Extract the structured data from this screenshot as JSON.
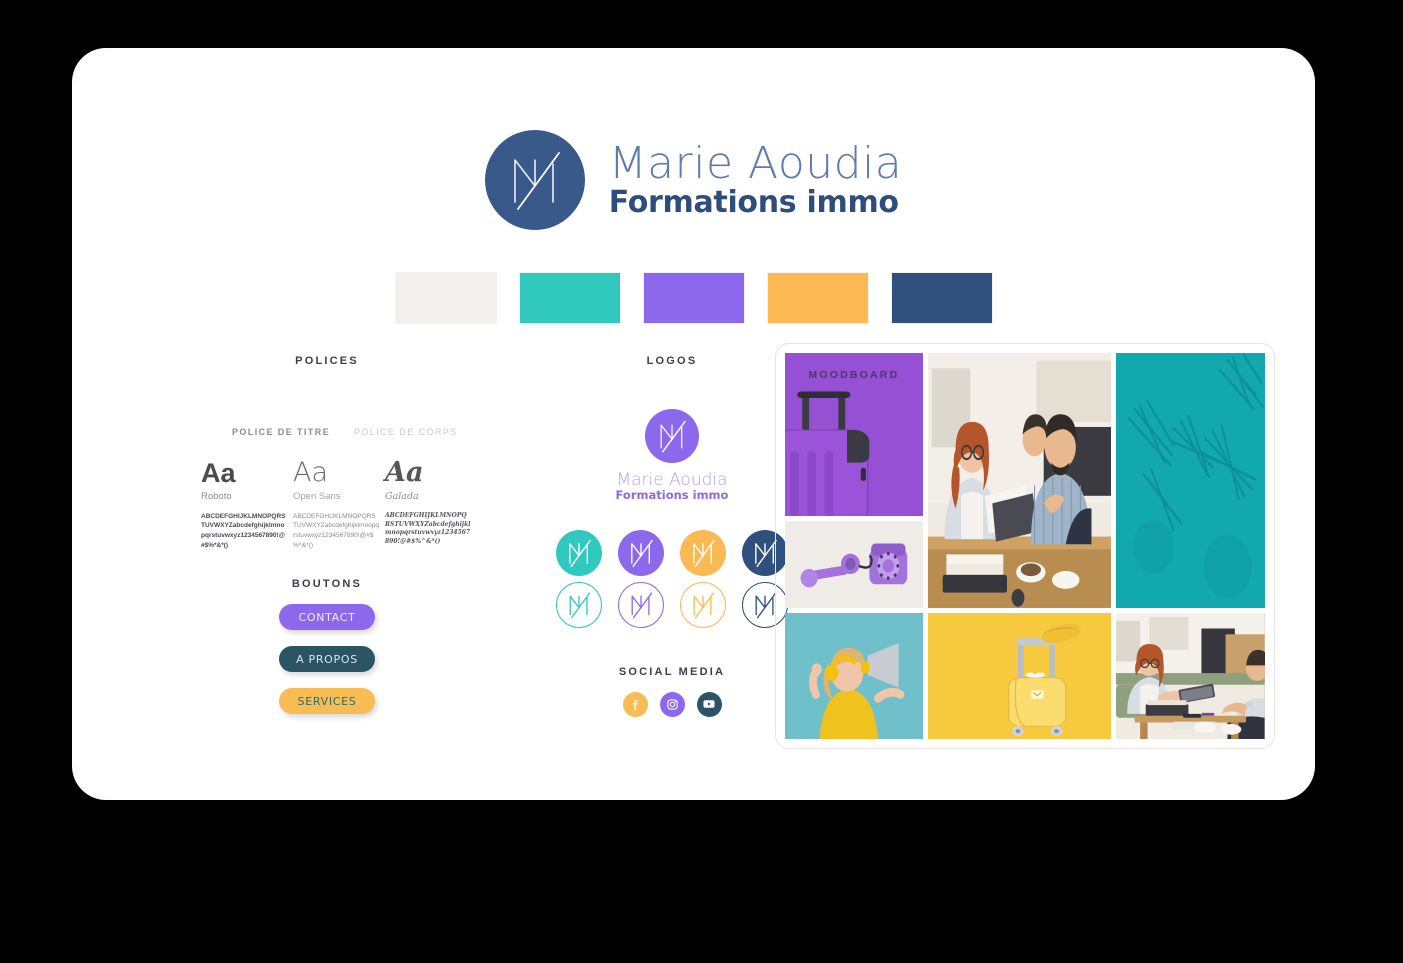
{
  "brand": {
    "logo_icon": "m-monogram-icon",
    "name_line1": "Marie Aoudia",
    "name_line2": "Formations immo"
  },
  "palette": {
    "label": "brand-color-palette",
    "swatches": [
      {
        "name": "cream",
        "hex": "#f2f0ec"
      },
      {
        "name": "teal",
        "hex": "#31c9be"
      },
      {
        "name": "purple",
        "hex": "#8b68ec"
      },
      {
        "name": "orange",
        "hex": "#fbb954"
      },
      {
        "name": "navy",
        "hex": "#2f4f7d"
      }
    ]
  },
  "polices": {
    "title": "POLICES",
    "kind_title": "POLICE DE TITRE",
    "kind_body": "POLICE DE CORPS",
    "specimens": [
      {
        "sample": "Aa",
        "name": "Roboto",
        "glyphs": "ABCDEFGHIJKLMNOPQRSTUVWXYZabcdefghijklmnopqrstuvwxyz1234567890!@#$%*&*()"
      },
      {
        "sample": "Aa",
        "name": "Open Sans",
        "glyphs": "ABCDEFGHIJKLMNOPQRSTUVWXYZabcdefghijklmnopqrstuvwxyz1234567890!@#$%^&*()"
      },
      {
        "sample": "Aa",
        "name": "Galada",
        "glyphs": "ABCDEFGHIJKLMNOPQRSTUVWXYZabcdefghijklmnopqrstuvwxyz1234567890!@#$%^&*()"
      }
    ]
  },
  "boutons": {
    "title": "BOUTONS",
    "buttons": [
      {
        "label": "CONTACT",
        "bg": "#8b68ec",
        "fg": "#f0ecfb"
      },
      {
        "label": "A PROPOS",
        "bg": "#2b5564",
        "fg": "#dce6ea"
      },
      {
        "label": "SERVICES",
        "bg": "#f7bd52",
        "fg": "#2b6a6a"
      }
    ],
    "cursor_icon": "cursor-pointer-icon"
  },
  "logos": {
    "title": "LOGOS",
    "primary": {
      "icon": "m-monogram-icon",
      "circle_hex": "#8b68ec",
      "name_line1": "Marie Aoudia",
      "name_line2": "Formations immo"
    },
    "variations": [
      {
        "name": "logo-teal-filled",
        "style": "filled",
        "hex": "#31c9be"
      },
      {
        "name": "logo-purple-filled",
        "style": "filled",
        "hex": "#8b68ec"
      },
      {
        "name": "logo-orange-filled",
        "style": "filled",
        "hex": "#fbb954"
      },
      {
        "name": "logo-navy-filled",
        "style": "filled",
        "hex": "#2f4f7d"
      },
      {
        "name": "logo-teal-outline",
        "style": "outline",
        "hex": "#31c9be"
      },
      {
        "name": "logo-purple-outline",
        "style": "outline",
        "hex": "#8b68ec"
      },
      {
        "name": "logo-orange-outline",
        "style": "outline",
        "hex": "#fbb954"
      },
      {
        "name": "logo-navy-outline",
        "style": "outline",
        "hex": "#2f4f7d"
      }
    ]
  },
  "social": {
    "title": "SOCIAL MEDIA",
    "icons": [
      {
        "name": "facebook-icon",
        "glyph": "f",
        "bg": "#f7bd52"
      },
      {
        "name": "instagram-icon",
        "glyph": "",
        "bg": "#8b68ec"
      },
      {
        "name": "youtube-icon",
        "glyph": "",
        "bg": "#2b5564"
      }
    ]
  },
  "moodboard": {
    "label": "MOODBOARD",
    "tiles": [
      {
        "name": "purple-suitcase-photo",
        "desc": "purple suitcase on purple background"
      },
      {
        "name": "retro-phone-photo",
        "desc": "lilac rotary telephone"
      },
      {
        "name": "megaphone-woman-photo",
        "desc": "woman with megaphone on teal background"
      },
      {
        "name": "meeting-photo",
        "desc": "three people reviewing documents"
      },
      {
        "name": "yellow-suitcase-photo",
        "desc": "yellow suitcase on yellow background"
      },
      {
        "name": "teal-texture-photo",
        "desc": "teal wall with palm leaf shadows"
      },
      {
        "name": "office-consult-photo",
        "desc": "woman presenting laptop to clients"
      }
    ]
  }
}
